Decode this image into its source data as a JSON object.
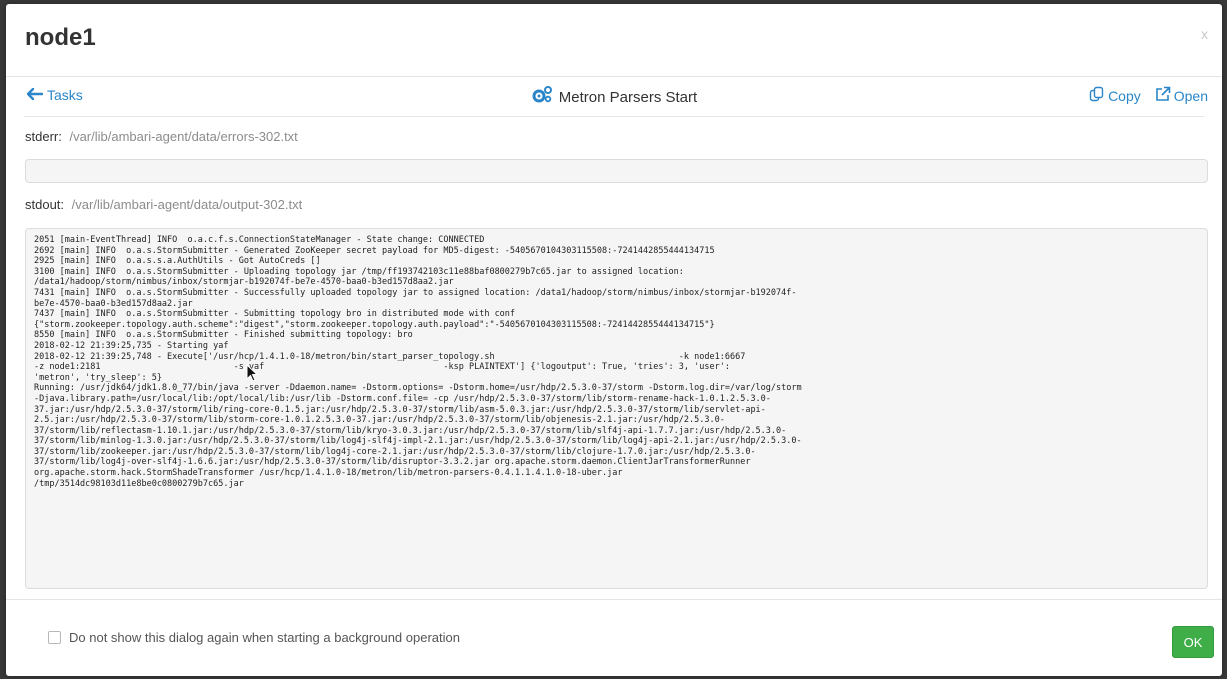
{
  "dialog": {
    "title": "node1",
    "close_label": "x"
  },
  "nav": {
    "back_label": "Tasks",
    "task_title": "Metron Parsers Start",
    "copy_label": "Copy",
    "open_label": "Open"
  },
  "stderr": {
    "label": "stderr:",
    "path": "/var/lib/ambari-agent/data/errors-302.txt"
  },
  "stdout": {
    "label": "stdout:",
    "path": "/var/lib/ambari-agent/data/output-302.txt",
    "lines": [
      "2051 [main-EventThread] INFO  o.a.c.f.s.ConnectionStateManager - State change: CONNECTED",
      "2692 [main] INFO  o.a.s.StormSubmitter - Generated ZooKeeper secret payload for MD5-digest: -5405670104303115508:-7241442855444134715",
      "2925 [main] INFO  o.a.s.s.a.AuthUtils - Got AutoCreds []",
      "3100 [main] INFO  o.a.s.StormSubmitter - Uploading topology jar /tmp/ff193742103c11e88baf0800279b7c65.jar to assigned location:",
      "/data1/hadoop/storm/nimbus/inbox/stormjar-b192074f-be7e-4570-baa0-b3ed157d8aa2.jar",
      "7431 [main] INFO  o.a.s.StormSubmitter - Successfully uploaded topology jar to assigned location: /data1/hadoop/storm/nimbus/inbox/stormjar-b192074f-",
      "be7e-4570-baa0-b3ed157d8aa2.jar",
      "7437 [main] INFO  o.a.s.StormSubmitter - Submitting topology bro in distributed mode with conf",
      "{\"storm.zookeeper.topology.auth.scheme\":\"digest\",\"storm.zookeeper.topology.auth.payload\":\"-5405670104303115508:-7241442855444134715\"}",
      "8550 [main] INFO  o.a.s.StormSubmitter - Finished submitting topology: bro",
      "2018-02-12 21:39:25,735 - Starting yaf",
      "2018-02-12 21:39:25,748 - Execute['/usr/hcp/1.4.1.0-18/metron/bin/start_parser_topology.sh                                    -k node1:6667",
      "-z node1:2181                          -s yaf                                   -ksp PLAINTEXT'] {'logoutput': True, 'tries': 3, 'user':",
      "'metron', 'try_sleep': 5}",
      "Running: /usr/jdk64/jdk1.8.0_77/bin/java -server -Ddaemon.name= -Dstorm.options= -Dstorm.home=/usr/hdp/2.5.3.0-37/storm -Dstorm.log.dir=/var/log/storm",
      "-Djava.library.path=/usr/local/lib:/opt/local/lib:/usr/lib -Dstorm.conf.file= -cp /usr/hdp/2.5.3.0-37/storm/lib/storm-rename-hack-1.0.1.2.5.3.0-",
      "37.jar:/usr/hdp/2.5.3.0-37/storm/lib/ring-core-0.1.5.jar:/usr/hdp/2.5.3.0-37/storm/lib/asm-5.0.3.jar:/usr/hdp/2.5.3.0-37/storm/lib/servlet-api-",
      "2.5.jar:/usr/hdp/2.5.3.0-37/storm/lib/storm-core-1.0.1.2.5.3.0-37.jar:/usr/hdp/2.5.3.0-37/storm/lib/objenesis-2.1.jar:/usr/hdp/2.5.3.0-",
      "37/storm/lib/reflectasm-1.10.1.jar:/usr/hdp/2.5.3.0-37/storm/lib/kryo-3.0.3.jar:/usr/hdp/2.5.3.0-37/storm/lib/slf4j-api-1.7.7.jar:/usr/hdp/2.5.3.0-",
      "37/storm/lib/minlog-1.3.0.jar:/usr/hdp/2.5.3.0-37/storm/lib/log4j-slf4j-impl-2.1.jar:/usr/hdp/2.5.3.0-37/storm/lib/log4j-api-2.1.jar:/usr/hdp/2.5.3.0-",
      "37/storm/lib/zookeeper.jar:/usr/hdp/2.5.3.0-37/storm/lib/log4j-core-2.1.jar:/usr/hdp/2.5.3.0-37/storm/lib/clojure-1.7.0.jar:/usr/hdp/2.5.3.0-",
      "37/storm/lib/log4j-over-slf4j-1.6.6.jar:/usr/hdp/2.5.3.0-37/storm/lib/disruptor-3.3.2.jar org.apache.storm.daemon.ClientJarTransformerRunner",
      "org.apache.storm.hack.StormShadeTransformer /usr/hcp/1.4.1.0-18/metron/lib/metron-parsers-0.4.1.1.4.1.0-18-uber.jar",
      "/tmp/3514dc98103d11e8be0c0800279b7c65.jar"
    ]
  },
  "footer": {
    "dont_show_label": "Do not show this dialog again when starting a background operation",
    "ok_label": "OK"
  },
  "colors": {
    "link": "#2a86c9",
    "ok_button": "#3fae49",
    "overlay": "#3a3a3a"
  },
  "icons": [
    "close-icon",
    "arrow-left-icon",
    "gears-icon",
    "copy-icon",
    "external-link-icon",
    "mouse-cursor-icon"
  ]
}
